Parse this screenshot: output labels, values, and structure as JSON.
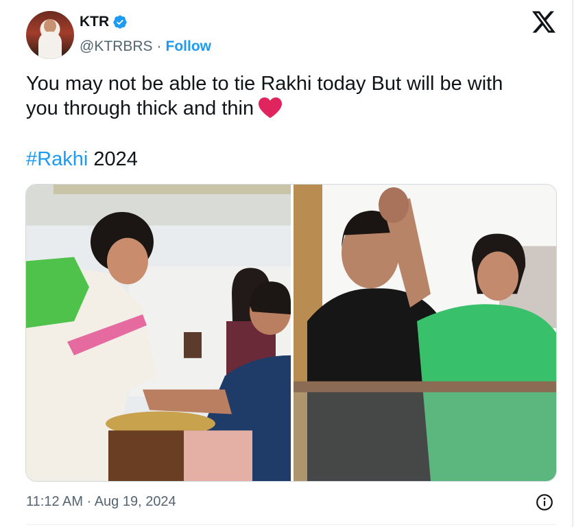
{
  "author": {
    "name": "KTR",
    "handle": "@KTRBRS",
    "separator": "·",
    "follow_label": "Follow",
    "verified": true
  },
  "platform_icon": "x-logo-icon",
  "tweet": {
    "line1": "You may not be able to tie Rakhi today But will be with",
    "line2": "you through thick and thin",
    "emoji": "heart-icon",
    "hashtag": "#Rakhi",
    "hashtag_suffix": " 2024"
  },
  "media": {
    "count": 2
  },
  "meta": {
    "timestamp": "11:12 AM · Aug 19, 2024",
    "info_icon": "info-icon"
  },
  "colors": {
    "accent": "#1d9bf0",
    "text": "#0f1419",
    "secondary": "#536471",
    "heart": "#e0245e"
  }
}
